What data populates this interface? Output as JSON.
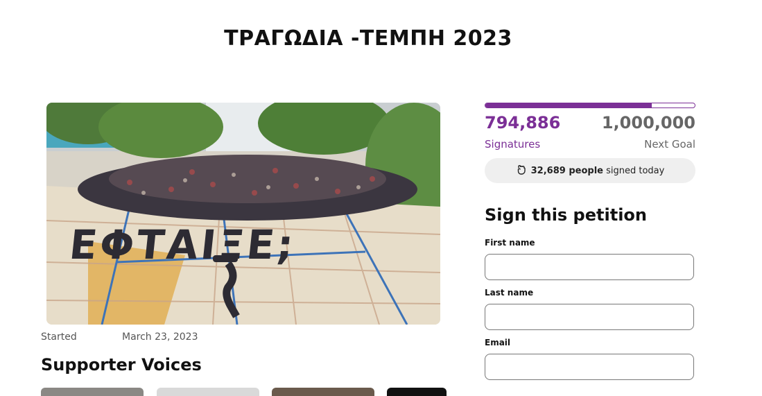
{
  "page": {
    "title": "ΤΡΑΓΩΔΙΑ -ΤΕΜΠΗ 2023"
  },
  "petition": {
    "started_label": "Started",
    "started_date": "March 23, 2023",
    "supporter_voices_title": "Supporter Voices",
    "photo_text": "ΕΦΤΑΙΞΕ;"
  },
  "stats": {
    "signatures": "794,886",
    "signatures_label": "Signatures",
    "goal": "1,000,000",
    "goal_label": "Next Goal",
    "progress_fraction": 0.795,
    "today_count": "32,689 people",
    "today_suffix": "signed today",
    "today_icon": "fist-icon"
  },
  "form": {
    "title": "Sign this petition",
    "first_name_label": "First name",
    "last_name_label": "Last name",
    "email_label": "Email",
    "first_name_value": "",
    "last_name_value": "",
    "email_value": ""
  },
  "colors": {
    "accent": "#7b2f96",
    "muted": "#666666"
  }
}
